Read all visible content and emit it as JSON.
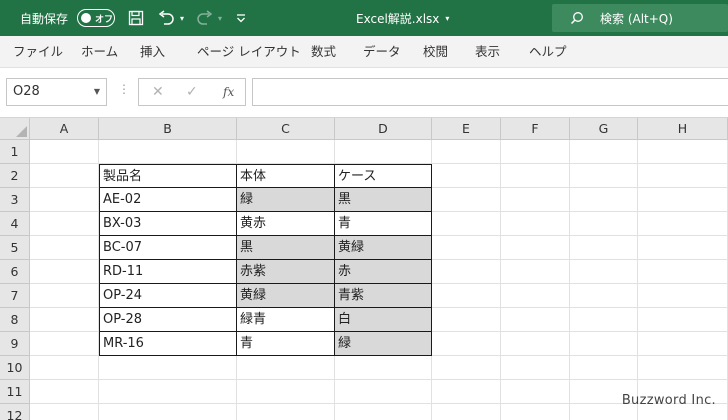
{
  "titlebar": {
    "autosave_label": "自動保存",
    "autosave_state": "オフ",
    "filename": "Excel解説.xlsx",
    "search_label": "検索 (Alt+Q)",
    "background": "#217346"
  },
  "menu": [
    "ファイル",
    "ホーム",
    "挿入",
    "ページ レイアウト",
    "数式",
    "データ",
    "校閲",
    "表示",
    "ヘルプ"
  ],
  "formula_bar": {
    "name_box": "O28",
    "formula": ""
  },
  "grid": {
    "columns": [
      "A",
      "B",
      "C",
      "D",
      "E",
      "F",
      "G",
      "H"
    ],
    "rows": [
      "1",
      "2",
      "3",
      "4",
      "5",
      "6",
      "7",
      "8",
      "9",
      "10",
      "11",
      "12"
    ],
    "table": {
      "header": [
        "製品名",
        "本体",
        "ケース"
      ],
      "data": [
        [
          "AE-02",
          "緑",
          "黒"
        ],
        [
          "BX-03",
          "黄赤",
          "青"
        ],
        [
          "BC-07",
          "黒",
          "黄緑"
        ],
        [
          "RD-11",
          "赤紫",
          "赤"
        ],
        [
          "OP-24",
          "黄緑",
          "青紫"
        ],
        [
          "OP-28",
          "緑青",
          "白"
        ],
        [
          "MR-16",
          "青",
          "緑"
        ]
      ],
      "shaded_cells": [
        "C3",
        "D3",
        "C5",
        "D5",
        "C6",
        "D6",
        "C7",
        "D7",
        "D8",
        "D9"
      ],
      "shade_color": "#d9d9d9"
    }
  },
  "watermark": "Buzzword Inc."
}
